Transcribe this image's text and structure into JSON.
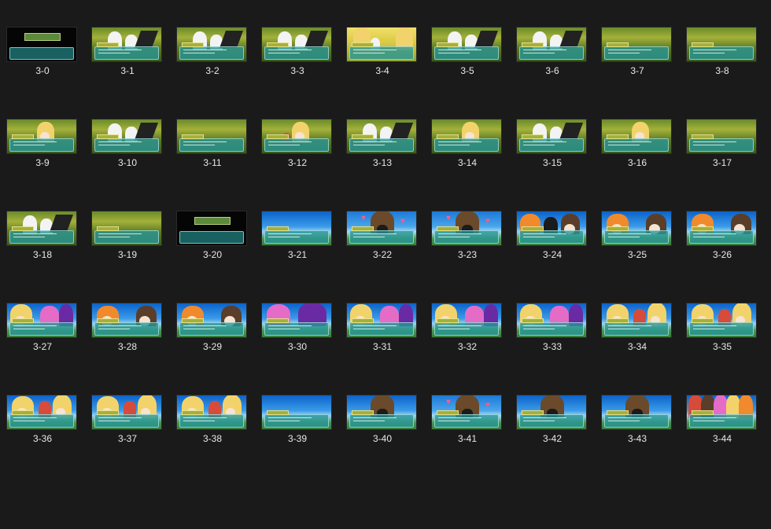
{
  "tiles": [
    {
      "label": "3-0",
      "scene": "black"
    },
    {
      "label": "3-1",
      "scene": "forest-white"
    },
    {
      "label": "3-2",
      "scene": "forest-white"
    },
    {
      "label": "3-3",
      "scene": "forest-white"
    },
    {
      "label": "3-4",
      "scene": "yellow-bunnies"
    },
    {
      "label": "3-5",
      "scene": "forest-white"
    },
    {
      "label": "3-6",
      "scene": "forest-white"
    },
    {
      "label": "3-7",
      "scene": "forest-empty"
    },
    {
      "label": "3-8",
      "scene": "forest-empty"
    },
    {
      "label": "3-9",
      "scene": "forest-blond"
    },
    {
      "label": "3-10",
      "scene": "forest-white"
    },
    {
      "label": "3-11",
      "scene": "forest-empty"
    },
    {
      "label": "3-12",
      "scene": "forest-red"
    },
    {
      "label": "3-13",
      "scene": "forest-white"
    },
    {
      "label": "3-14",
      "scene": "forest-blond"
    },
    {
      "label": "3-15",
      "scene": "forest-white"
    },
    {
      "label": "3-16",
      "scene": "forest-blond"
    },
    {
      "label": "3-17",
      "scene": "forest-empty"
    },
    {
      "label": "3-18",
      "scene": "forest-white"
    },
    {
      "label": "3-19",
      "scene": "forest-empty"
    },
    {
      "label": "3-20",
      "scene": "black"
    },
    {
      "label": "3-21",
      "scene": "sky-empty"
    },
    {
      "label": "3-22",
      "scene": "sky-hood-hearts"
    },
    {
      "label": "3-23",
      "scene": "sky-hood-hearts"
    },
    {
      "label": "3-24",
      "scene": "sky-trio"
    },
    {
      "label": "3-25",
      "scene": "sky-duo"
    },
    {
      "label": "3-26",
      "scene": "sky-duo"
    },
    {
      "label": "3-27",
      "scene": "sky-girls"
    },
    {
      "label": "3-28",
      "scene": "sky-duo"
    },
    {
      "label": "3-29",
      "scene": "sky-duo"
    },
    {
      "label": "3-30",
      "scene": "sky-wings"
    },
    {
      "label": "3-31",
      "scene": "sky-girls"
    },
    {
      "label": "3-32",
      "scene": "sky-girls"
    },
    {
      "label": "3-33",
      "scene": "sky-girls"
    },
    {
      "label": "3-34",
      "scene": "sky-blond"
    },
    {
      "label": "3-35",
      "scene": "sky-blond"
    },
    {
      "label": "3-36",
      "scene": "sky-blond"
    },
    {
      "label": "3-37",
      "scene": "sky-blond"
    },
    {
      "label": "3-38",
      "scene": "sky-blond"
    },
    {
      "label": "3-39",
      "scene": "sky-empty"
    },
    {
      "label": "3-40",
      "scene": "sky-hood"
    },
    {
      "label": "3-41",
      "scene": "sky-hood-hearts"
    },
    {
      "label": "3-42",
      "scene": "sky-hood"
    },
    {
      "label": "3-43",
      "scene": "sky-hood"
    },
    {
      "label": "3-44",
      "scene": "sky-crowd"
    }
  ]
}
